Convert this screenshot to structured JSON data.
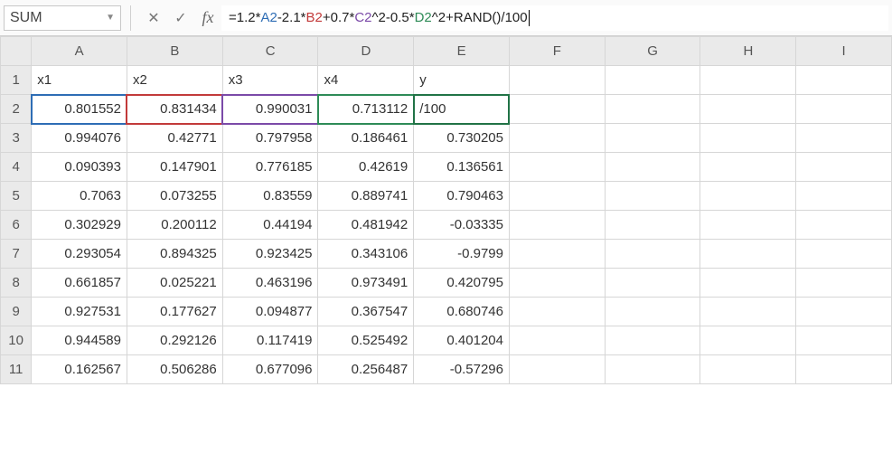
{
  "namebox": {
    "value": "SUM"
  },
  "formula_bar": {
    "cancel_glyph": "✕",
    "confirm_glyph": "✓",
    "fx_label": "fx",
    "formula_prefix": "=1.2*",
    "ref_a": "A2",
    "seg1": "-2.1*",
    "ref_b": "B2",
    "seg2": "+0.7*",
    "ref_c": "C2",
    "seg3": "^2-0.5*",
    "ref_d": "D2",
    "seg4": "^2+RAND()/100"
  },
  "columns": [
    "A",
    "B",
    "C",
    "D",
    "E",
    "F",
    "G",
    "H",
    "I"
  ],
  "row_numbers": [
    "1",
    "2",
    "3",
    "4",
    "5",
    "6",
    "7",
    "8",
    "9",
    "10",
    "11"
  ],
  "headers": {
    "A": "x1",
    "B": "x2",
    "C": "x3",
    "D": "x4",
    "E": "y"
  },
  "edit_cell_display": "/100",
  "chart_data": {
    "type": "table",
    "title": "",
    "columns": [
      "x1",
      "x2",
      "x3",
      "x4",
      "y"
    ],
    "rows": [
      {
        "x1": "0.801552",
        "x2": "0.831434",
        "x3": "0.990031",
        "x4": "0.713112",
        "y": "/100"
      },
      {
        "x1": "0.994076",
        "x2": "0.42771",
        "x3": "0.797958",
        "x4": "0.186461",
        "y": "0.730205"
      },
      {
        "x1": "0.090393",
        "x2": "0.147901",
        "x3": "0.776185",
        "x4": "0.42619",
        "y": "0.136561"
      },
      {
        "x1": "0.7063",
        "x2": "0.073255",
        "x3": "0.83559",
        "x4": "0.889741",
        "y": "0.790463"
      },
      {
        "x1": "0.302929",
        "x2": "0.200112",
        "x3": "0.44194",
        "x4": "0.481942",
        "y": "-0.03335"
      },
      {
        "x1": "0.293054",
        "x2": "0.894325",
        "x3": "0.923425",
        "x4": "0.343106",
        "y": "-0.9799"
      },
      {
        "x1": "0.661857",
        "x2": "0.025221",
        "x3": "0.463196",
        "x4": "0.973491",
        "y": "0.420795"
      },
      {
        "x1": "0.927531",
        "x2": "0.177627",
        "x3": "0.094877",
        "x4": "0.367547",
        "y": "0.680746"
      },
      {
        "x1": "0.944589",
        "x2": "0.292126",
        "x3": "0.117419",
        "x4": "0.525492",
        "y": "0.401204"
      },
      {
        "x1": "0.162567",
        "x2": "0.506286",
        "x3": "0.677096",
        "x4": "0.256487",
        "y": "-0.57296"
      }
    ]
  }
}
